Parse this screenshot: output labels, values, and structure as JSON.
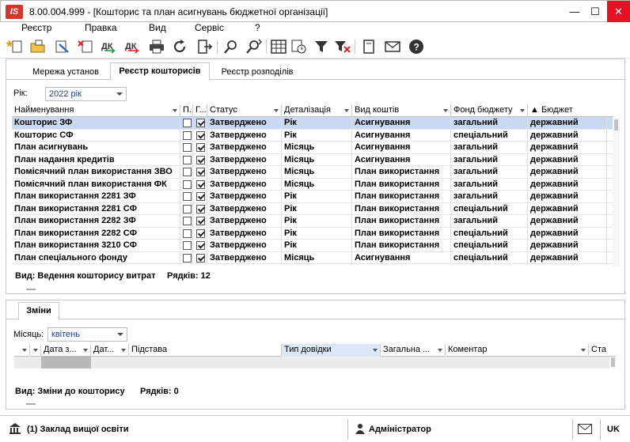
{
  "window": {
    "logo": "IS",
    "title": "8.00.004.999 - [Кошторис та план асигнувань бюджетної організації]",
    "minimize": "—",
    "maximize": "☐",
    "close": "✕"
  },
  "menu": {
    "items": [
      "Реєстр",
      "Правка",
      "Вид",
      "Сервіс",
      "?"
    ]
  },
  "toolbar": {
    "icons": [
      "new-doc-icon",
      "open-folder-icon",
      "edit-doc-icon",
      "delete-doc-icon",
      "debit-credit-icon",
      "debit-credit-red-icon",
      "print-icon",
      "refresh-icon",
      "exit-icon",
      "search-icon",
      "search-next-icon",
      "table-icon",
      "calendar-clock-icon",
      "filter-icon",
      "clear-filter-icon",
      "document-icon",
      "mail-icon",
      "help-icon"
    ]
  },
  "tabs": [
    "Мережа установ",
    "Реєстр кошторисів",
    "Реєстр розподілів"
  ],
  "active_tab": "Реєстр кошторисів",
  "year": {
    "label": "Рік:",
    "value": "2022 рік"
  },
  "main_grid": {
    "columns": [
      "Найменування",
      "П...",
      "Г...",
      "Статус",
      "Деталізація",
      "Вид коштів",
      "Фонд бюджету",
      "▲ Бюджет"
    ],
    "rows": [
      {
        "name": "Кошторис ЗФ",
        "p": false,
        "g": true,
        "status": "Затверджено",
        "detail": "Рік",
        "kind": "Асигнування",
        "fund": "загальний",
        "budget": "державний",
        "selected": true
      },
      {
        "name": "Кошторис СФ",
        "p": false,
        "g": true,
        "status": "Затверджено",
        "detail": "Рік",
        "kind": "Асигнування",
        "fund": "спеціальний",
        "budget": "державний"
      },
      {
        "name": "План асигнувань",
        "p": false,
        "g": true,
        "status": "Затверджено",
        "detail": "Місяць",
        "kind": "Асигнування",
        "fund": "загальний",
        "budget": "державний"
      },
      {
        "name": "План надання кредитів",
        "p": false,
        "g": true,
        "status": "Затверджено",
        "detail": "Місяць",
        "kind": "Асигнування",
        "fund": "загальний",
        "budget": "державний"
      },
      {
        "name": "Помісячний план використання ЗВО",
        "p": false,
        "g": true,
        "status": "Затверджено",
        "detail": "Місяць",
        "kind": "План використання",
        "fund": "загальний",
        "budget": "державний"
      },
      {
        "name": "Помісячний план використання ФК",
        "p": false,
        "g": true,
        "status": "Затверджено",
        "detail": "Місяць",
        "kind": "План використання",
        "fund": "загальний",
        "budget": "державний"
      },
      {
        "name": "План використання 2281 ЗФ",
        "p": false,
        "g": true,
        "status": "Затверджено",
        "detail": "Рік",
        "kind": "План використання",
        "fund": "загальний",
        "budget": "державний"
      },
      {
        "name": "План використання 2281 СФ",
        "p": false,
        "g": true,
        "status": "Затверджено",
        "detail": "Рік",
        "kind": "План використання",
        "fund": "спеціальний",
        "budget": "державний"
      },
      {
        "name": "План використання 2282 ЗФ",
        "p": false,
        "g": true,
        "status": "Затверджено",
        "detail": "Рік",
        "kind": "План використання",
        "fund": "загальний",
        "budget": "державний"
      },
      {
        "name": "План використання 2282 СФ",
        "p": false,
        "g": true,
        "status": "Затверджено",
        "detail": "Рік",
        "kind": "План використання",
        "fund": "спеціальний",
        "budget": "державний"
      },
      {
        "name": "План використання 3210 СФ",
        "p": false,
        "g": true,
        "status": "Затверджено",
        "detail": "Рік",
        "kind": "План використання",
        "fund": "спеціальний",
        "budget": "державний"
      },
      {
        "name": "План спеціального фонду",
        "p": false,
        "g": true,
        "status": "Затверджено",
        "detail": "Місяць",
        "kind": "Асигнування",
        "fund": "спеціальний",
        "budget": "державний"
      }
    ],
    "footer_view": "Вид: Ведення кошторису витрат",
    "footer_rows": "Рядків: 12"
  },
  "changes": {
    "tab": "Зміни",
    "month_label": "Місяць:",
    "month_value": "квітень",
    "columns": [
      "",
      "Дата з...",
      "Дат...",
      "Підстава",
      "Тип довідки",
      "Загальна ...",
      "Коментар",
      "Ста"
    ],
    "footer_view": "Вид: Зміни до кошторису",
    "footer_rows": "Рядків: 0"
  },
  "statusbar": {
    "org": "(1) Заклад вищої освіти",
    "user": "Адміністратор",
    "lang": "UK"
  }
}
